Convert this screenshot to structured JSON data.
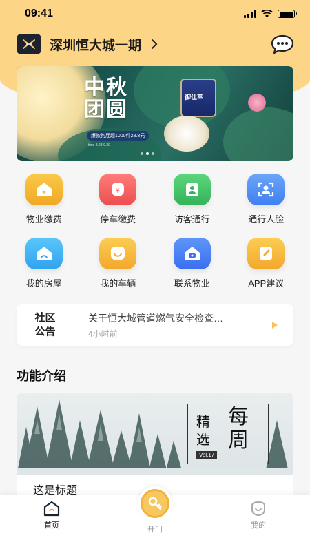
{
  "status_bar": {
    "time": "09:41"
  },
  "header": {
    "community": "深圳恒大城一期"
  },
  "banner": {
    "title": "中秋团圆",
    "product": "御仕萃",
    "promo": "爆款狗屁超1000件28.8元",
    "date": "time 8.28-9.30"
  },
  "services": [
    {
      "label": "物业缴费",
      "icon": "property-fee-icon",
      "color": "#f3b52f"
    },
    {
      "label": "停车缴费",
      "icon": "parking-fee-icon",
      "color": "#f0625f"
    },
    {
      "label": "访客通行",
      "icon": "visitor-pass-icon",
      "color": "#4ec66e"
    },
    {
      "label": "通行人脸",
      "icon": "face-pass-icon",
      "color": "#4e8ff2"
    },
    {
      "label": "我的房屋",
      "icon": "my-house-icon",
      "color": "#45b5f2"
    },
    {
      "label": "我的车辆",
      "icon": "my-vehicle-icon",
      "color": "#f6b93d"
    },
    {
      "label": "联系物业",
      "icon": "contact-property-icon",
      "color": "#3f7ff2"
    },
    {
      "label": "APP建议",
      "icon": "app-feedback-icon",
      "color": "#f6b93d"
    }
  ],
  "notice": {
    "tag_line1": "社区",
    "tag_line2": "公告",
    "text": "关于恒大城管道燃气安全检查…",
    "time": "4小时前"
  },
  "section": {
    "title": "功能介绍"
  },
  "card": {
    "title": "这是标题",
    "weekly_big": "每周",
    "weekly_small": "精选",
    "vol": "Vol.17"
  },
  "tabbar": {
    "home": "首页",
    "open": "开门",
    "mine": "我的"
  }
}
